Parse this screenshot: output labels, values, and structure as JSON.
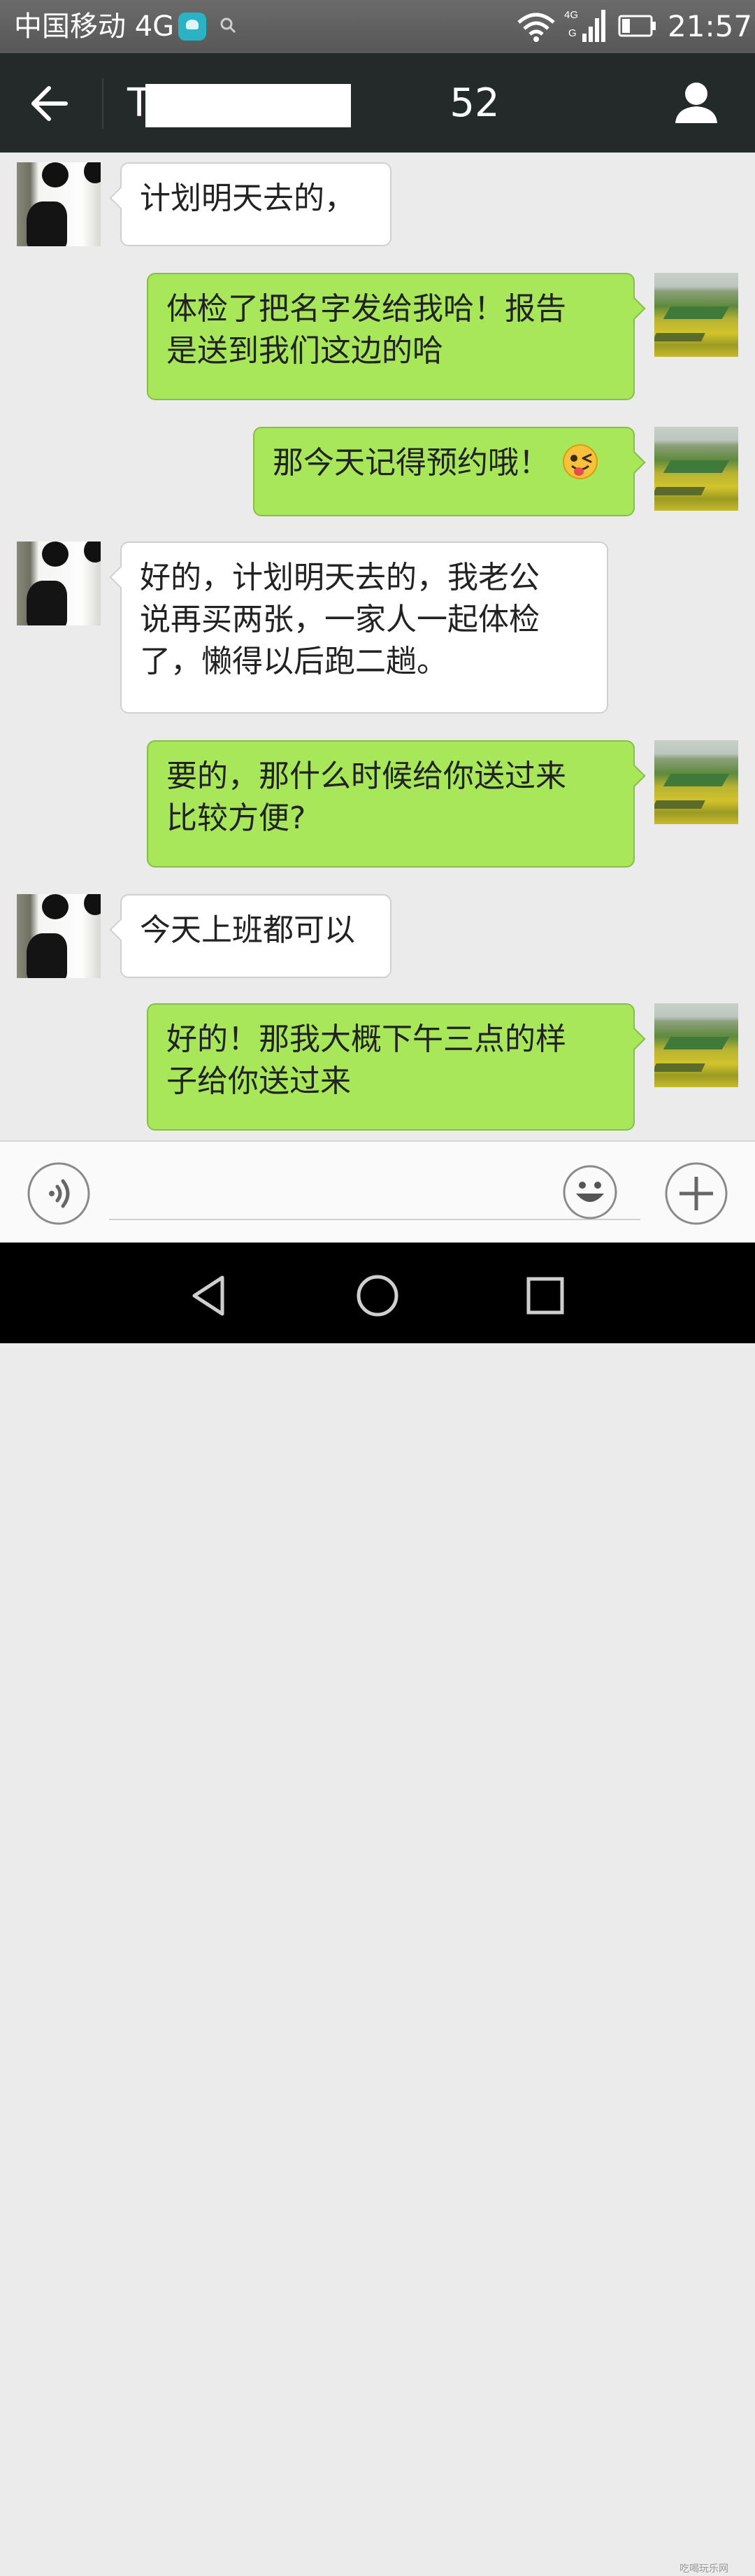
{
  "status_bar": {
    "carrier": "中国移动 4G",
    "time": "21:57",
    "network_badge_top": "4G",
    "network_badge_bottom": "G"
  },
  "header": {
    "title": "T                        52",
    "back_icon": "arrow-left-icon",
    "profile_icon": "person-icon"
  },
  "messages": [
    {
      "from": "contact",
      "text": "计划明天去的，",
      "avatar_icon": "panda-avatar"
    },
    {
      "from": "me",
      "text": "体检了把名字发给我哈！报告\n是送到我们这边的哈",
      "avatar_icon": "field-avatar"
    },
    {
      "from": "me",
      "text": "那今天记得预约哦！",
      "emoji": "winking-tongue-emoji",
      "avatar_icon": "field-avatar"
    },
    {
      "from": "contact",
      "text": "好的，计划明天去的，我老公\n说再买两张，一家人一起体检\n了，懒得以后跑二趟。",
      "avatar_icon": "panda-avatar"
    },
    {
      "from": "me",
      "text": "要的，那什么时候给你送过来\n比较方便?",
      "avatar_icon": "field-avatar"
    },
    {
      "from": "contact",
      "text": "今天上班都可以",
      "avatar_icon": "panda-avatar"
    },
    {
      "from": "me",
      "text": "好的！那我大概下午三点的样\n子给你送过来",
      "avatar_icon": "field-avatar"
    }
  ],
  "input_bar": {
    "value": "",
    "voice_icon": "voice-icon",
    "emoji_icon": "smiley-icon",
    "more_icon": "plus-icon"
  },
  "system_nav": {
    "back_icon": "triangle-back-icon",
    "home_icon": "circle-home-icon",
    "recents_icon": "square-recents-icon"
  },
  "watermark": "吃喝玩乐网"
}
